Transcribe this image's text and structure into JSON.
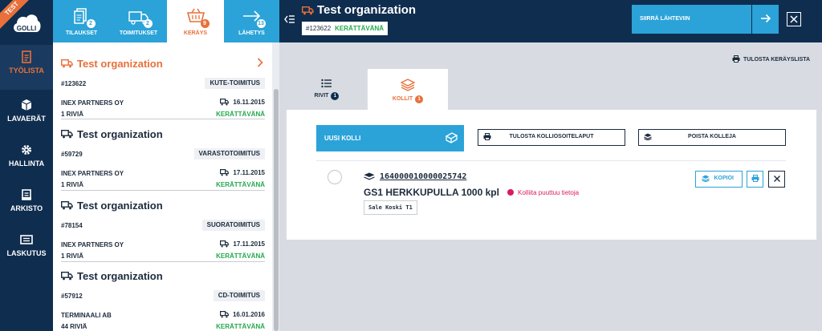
{
  "app": {
    "env_badge": "TEST",
    "logo_text": "GOLLI"
  },
  "nav": [
    {
      "label": "TYÖLISTA",
      "icon": "clipboard-icon",
      "active": true
    },
    {
      "label": "LAVAERÄT",
      "icon": "box-icon",
      "active": false
    },
    {
      "label": "HALLINTA",
      "icon": "gear-icon",
      "active": false
    },
    {
      "label": "ARKISTO",
      "icon": "archive-icon",
      "active": false
    },
    {
      "label": "LASKUTUS",
      "icon": "invoice-icon",
      "active": false
    }
  ],
  "top_tabs": [
    {
      "label": "TILAUKSET",
      "count": "2",
      "icon": "documents-icon"
    },
    {
      "label": "TOIMITUKSET",
      "count": "2",
      "icon": "truck-icon"
    },
    {
      "label": "KERÄYS",
      "count": "9",
      "icon": "basket-icon",
      "active": true
    },
    {
      "label": "LÄHETYS",
      "count": "13",
      "icon": "arrow-right-icon"
    }
  ],
  "list": [
    {
      "title": "Test organization",
      "number": "#123622",
      "type": "KUTE-TOIMITUS",
      "company": "INEX PARTNERS OY",
      "date": "16.11.2015",
      "rows": "1 RIVIÄ",
      "status": "KERÄTTÄVÄNÄ",
      "active": true
    },
    {
      "title": "Test organization",
      "number": "#59729",
      "type": "VARASTOTOIMITUS",
      "company": "INEX PARTNERS OY",
      "date": "17.11.2015",
      "rows": "1 RIVIÄ",
      "status": "KERÄTTÄVÄNÄ"
    },
    {
      "title": "Test organization",
      "number": "#78154",
      "type": "SUORATOIMITUS",
      "company": "INEX PARTNERS OY",
      "date": "17.11.2015",
      "rows": "1 RIVIÄ",
      "status": "KERÄTTÄVÄNÄ"
    },
    {
      "title": "Test organization",
      "number": "#57912",
      "type": "CD-TOIMITUS",
      "company": "TERMINAALI AB",
      "date": "16.01.2016",
      "rows": "44 RIVIÄ",
      "status": "KERÄTTÄVÄNÄ"
    }
  ],
  "header": {
    "title": "Test organization",
    "number": "#123622",
    "status": "KERÄTTÄVÄNÄ",
    "move_button": "SIIRRÄ LÄHTEVIIN"
  },
  "print_list_label": "TULOSTA KERÄYSLISTA",
  "content_tabs": [
    {
      "label": "RIVIT",
      "count": "1"
    },
    {
      "label": "KOLLIT",
      "count": "1",
      "active": true
    }
  ],
  "toolbar": {
    "new_label": "UUSI KOLLI",
    "print_label": "TULOSTA KOLLIOSOITELAPUT",
    "remove_label": "POISTA KOLLEJA"
  },
  "package": {
    "barcode": "164000010000025742",
    "name": "GS1 HERKKUPULLA 1000 kpl",
    "warning": "Kolliita puuttuu tietoja",
    "tag": "Sale Koski T1",
    "copy_label": "KOPIOI"
  },
  "colors": {
    "navy": "#0f2d4f",
    "accent": "#e8703a",
    "blue": "#2ba3d8",
    "green": "#23a84e",
    "warning": "#d81b60"
  }
}
